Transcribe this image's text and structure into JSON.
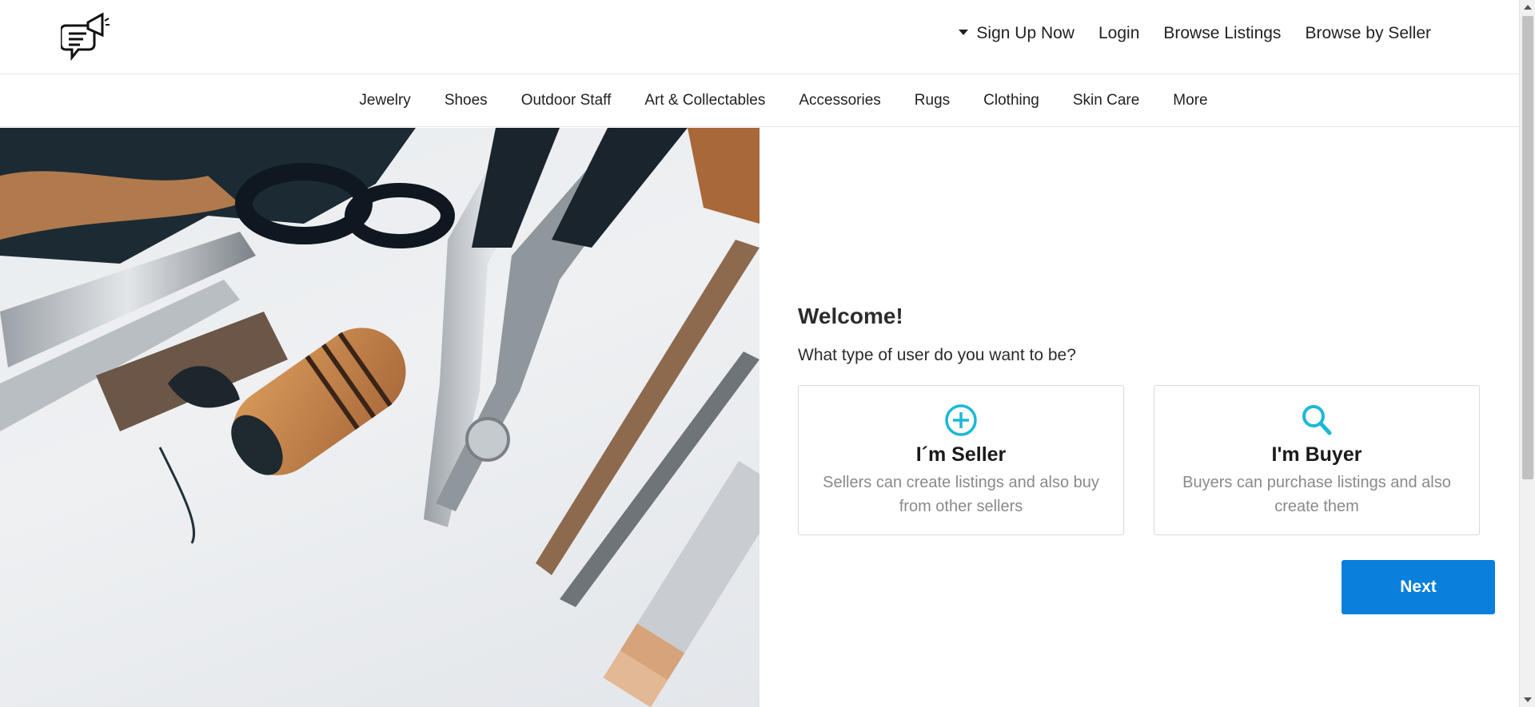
{
  "header": {
    "logo_icon": "chat-megaphone-logo-icon",
    "nav": [
      {
        "label": "Sign Up Now",
        "has_caret": true
      },
      {
        "label": "Login"
      },
      {
        "label": "Browse Listings"
      },
      {
        "label": "Browse by Seller"
      }
    ]
  },
  "categories": [
    "Jewelry",
    "Shoes",
    "Outdoor Staff",
    "Art & Collectables",
    "Accessories",
    "Rugs",
    "Clothing",
    "Skin Care",
    "More"
  ],
  "hero": {
    "image_icon": "craft-tools-photo"
  },
  "onboarding": {
    "welcome": "Welcome!",
    "question": "What type of user do you want to be?",
    "seller": {
      "title": "I´m Seller",
      "description": "Sellers can create listings and also buy from other sellers",
      "icon": "plus-circle-icon"
    },
    "buyer": {
      "title": "I'm Buyer",
      "description": "Buyers can purchase listings and also create them",
      "icon": "search-icon"
    },
    "next_label": "Next"
  },
  "colors": {
    "accent_icon": "#1bb8d8",
    "primary_button": "#0a7fdc"
  }
}
